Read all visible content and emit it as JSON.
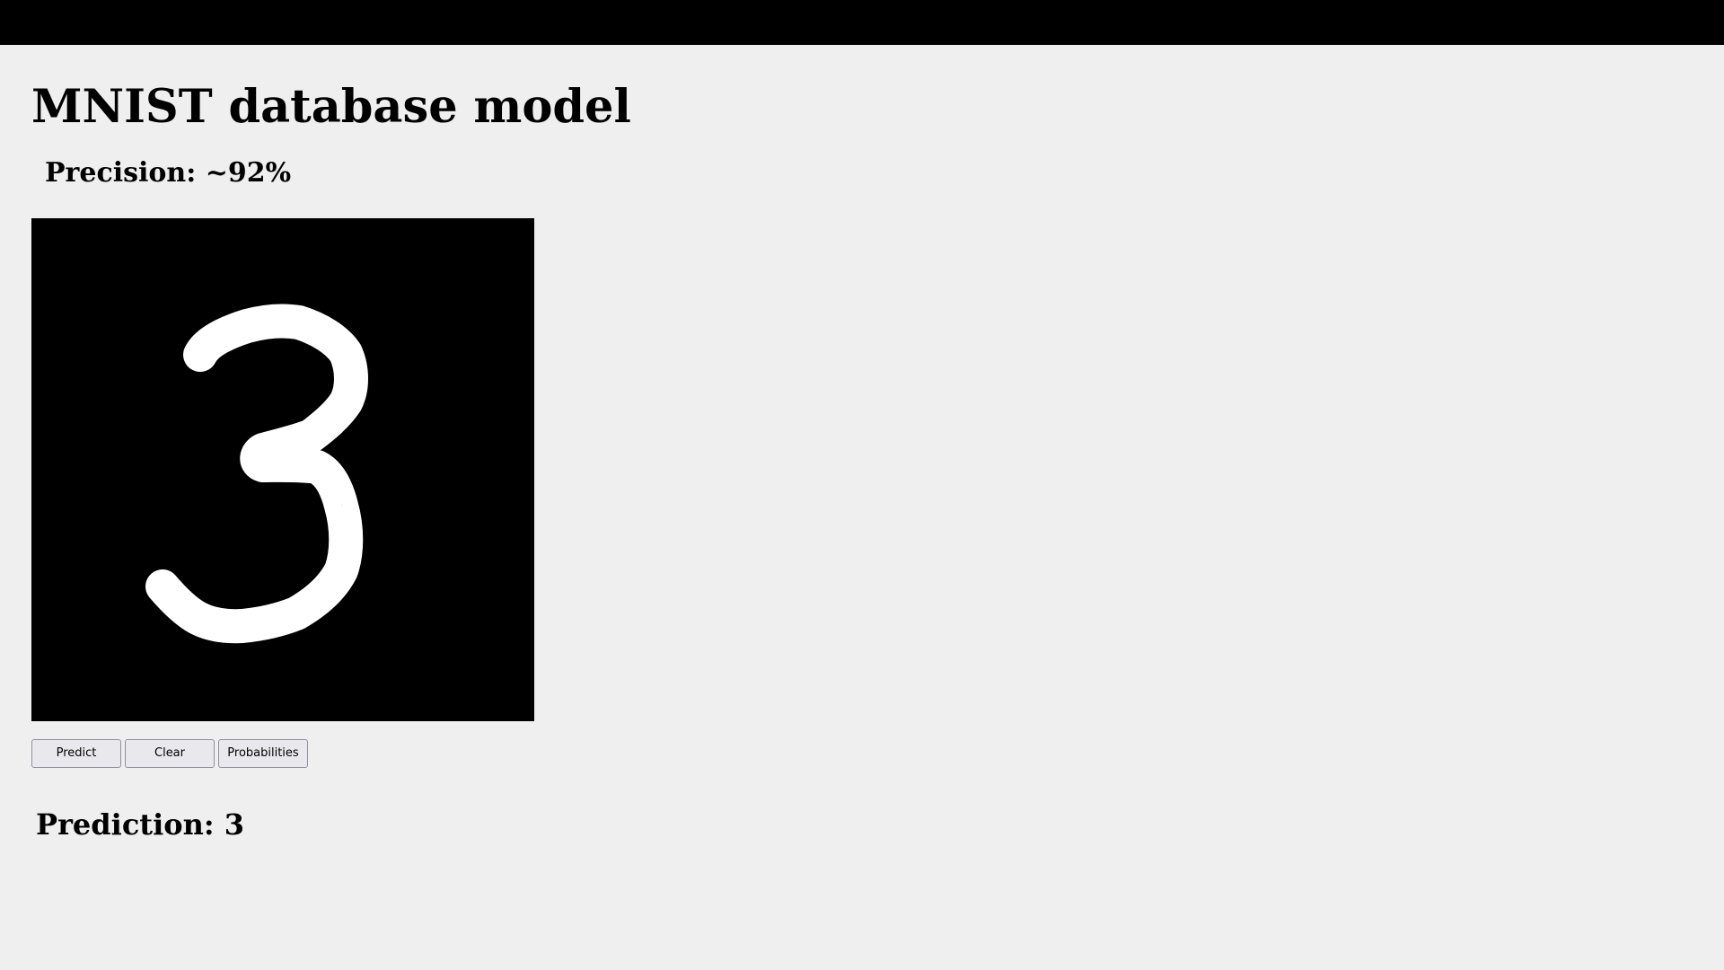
{
  "header": {
    "title": "MNIST database model",
    "precision": "Precision: ~92%"
  },
  "canvas": {
    "drawn_digit": "3",
    "background_color": "#000000",
    "stroke_color": "#ffffff"
  },
  "buttons": {
    "predict": "Predict",
    "clear": "Clear",
    "probabilities": "Probabilities"
  },
  "result": {
    "prediction": "Prediction: 3"
  },
  "colors": {
    "page_background": "#efefef",
    "top_bar": "#000000"
  }
}
